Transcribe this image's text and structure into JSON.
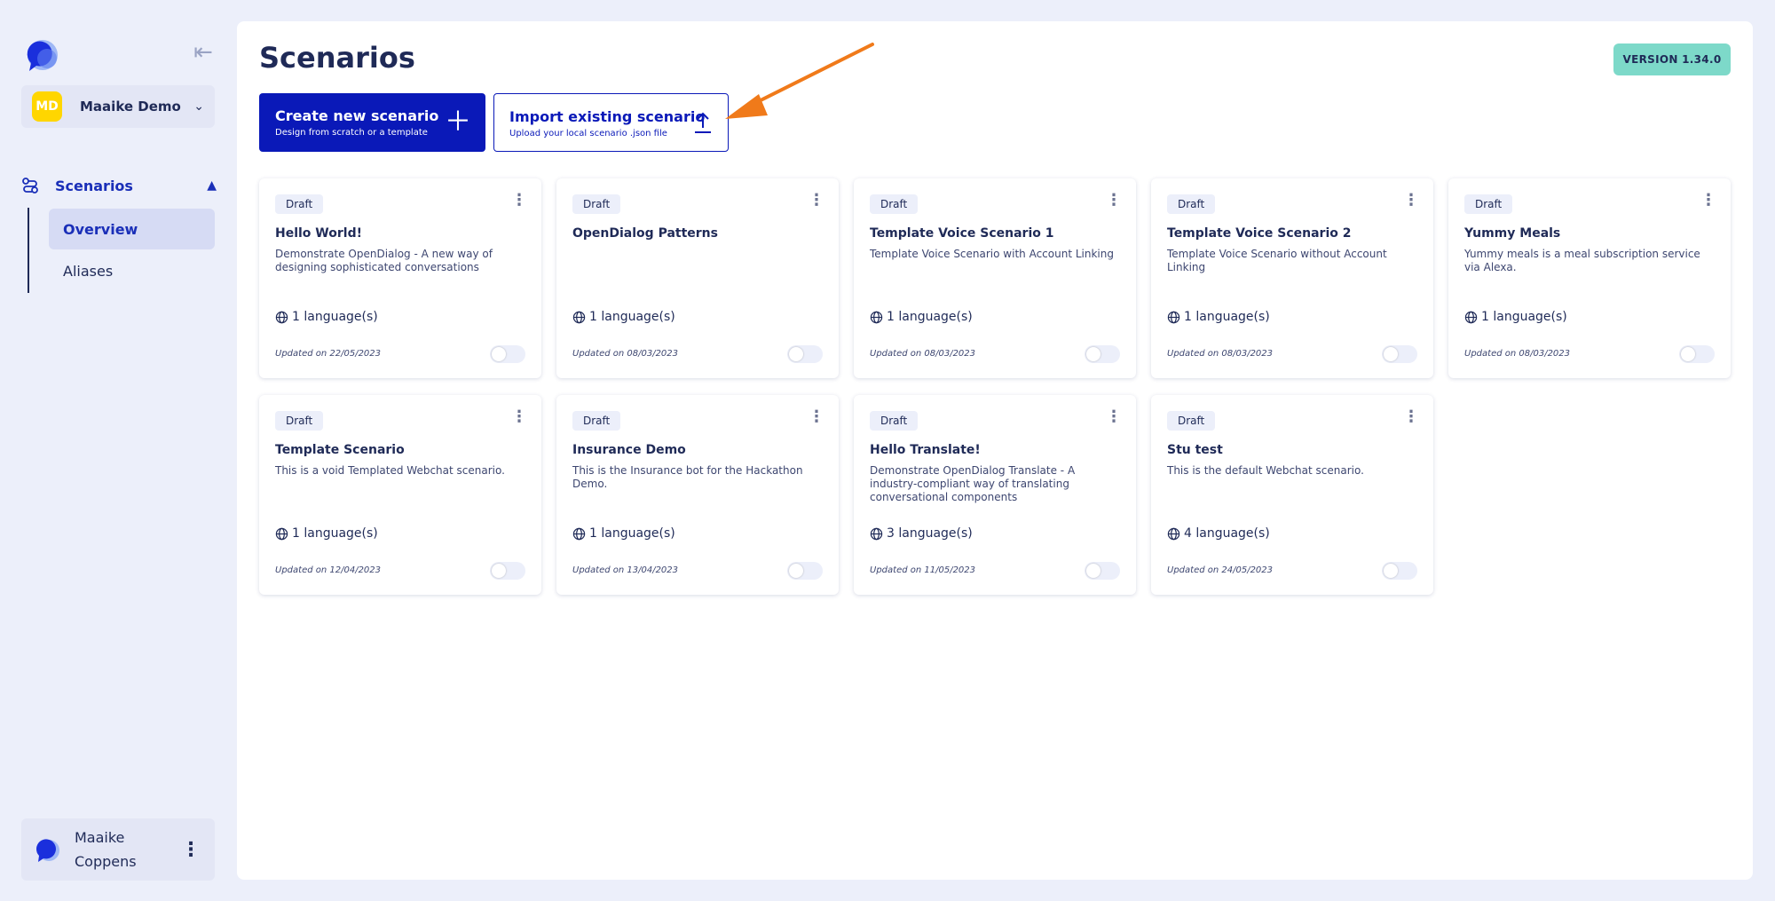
{
  "sidebar": {
    "workspace": {
      "initials": "MD",
      "name": "Maaike Demo"
    },
    "section": {
      "label": "Scenarios"
    },
    "items": [
      {
        "label": "Overview",
        "active": true
      },
      {
        "label": "Aliases",
        "active": false
      }
    ],
    "user": {
      "first": "Maaike",
      "last": "Coppens"
    }
  },
  "main": {
    "title": "Scenarios",
    "version": "VERSION 1.34.0",
    "create": {
      "title": "Create new scenario",
      "subtitle": "Design from scratch or a template"
    },
    "import": {
      "title": "Import existing scenario",
      "subtitle": "Upload your local scenario .json file"
    }
  },
  "cards": [
    {
      "status": "Draft",
      "title": "Hello World!",
      "desc": "Demonstrate OpenDialog - A new way of designing sophisticated conversations",
      "langs": "1 language(s)",
      "updated": "Updated on 22/05/2023"
    },
    {
      "status": "Draft",
      "title": "OpenDialog Patterns",
      "desc": "",
      "langs": "1 language(s)",
      "updated": "Updated on 08/03/2023"
    },
    {
      "status": "Draft",
      "title": "Template Voice Scenario 1",
      "desc": "Template Voice Scenario with Account Linking",
      "langs": "1 language(s)",
      "updated": "Updated on 08/03/2023"
    },
    {
      "status": "Draft",
      "title": "Template Voice Scenario 2",
      "desc": "Template Voice Scenario without Account Linking",
      "langs": "1 language(s)",
      "updated": "Updated on 08/03/2023"
    },
    {
      "status": "Draft",
      "title": "Yummy Meals",
      "desc": "Yummy meals is a meal subscription service via Alexa.",
      "langs": "1 language(s)",
      "updated": "Updated on 08/03/2023"
    },
    {
      "status": "Draft",
      "title": "Template Scenario",
      "desc": "This is a void Templated Webchat scenario.",
      "langs": "1 language(s)",
      "updated": "Updated on 12/04/2023"
    },
    {
      "status": "Draft",
      "title": "Insurance Demo",
      "desc": "This is the Insurance bot for the Hackathon Demo.",
      "langs": "1 language(s)",
      "updated": "Updated on 13/04/2023"
    },
    {
      "status": "Draft",
      "title": "Hello Translate!",
      "desc": "Demonstrate OpenDialog Translate - A industry-compliant way of translating conversational components",
      "langs": "3 language(s)",
      "updated": "Updated on 11/05/2023"
    },
    {
      "status": "Draft",
      "title": "Stu test",
      "desc": "This is the default Webchat scenario.",
      "langs": "4 language(s)",
      "updated": "Updated on 24/05/2023"
    }
  ],
  "colors": {
    "primary": "#0a19b8",
    "accent": "#7dd9c9",
    "annotation": "#f07a1a",
    "badge": "#ffd600"
  }
}
